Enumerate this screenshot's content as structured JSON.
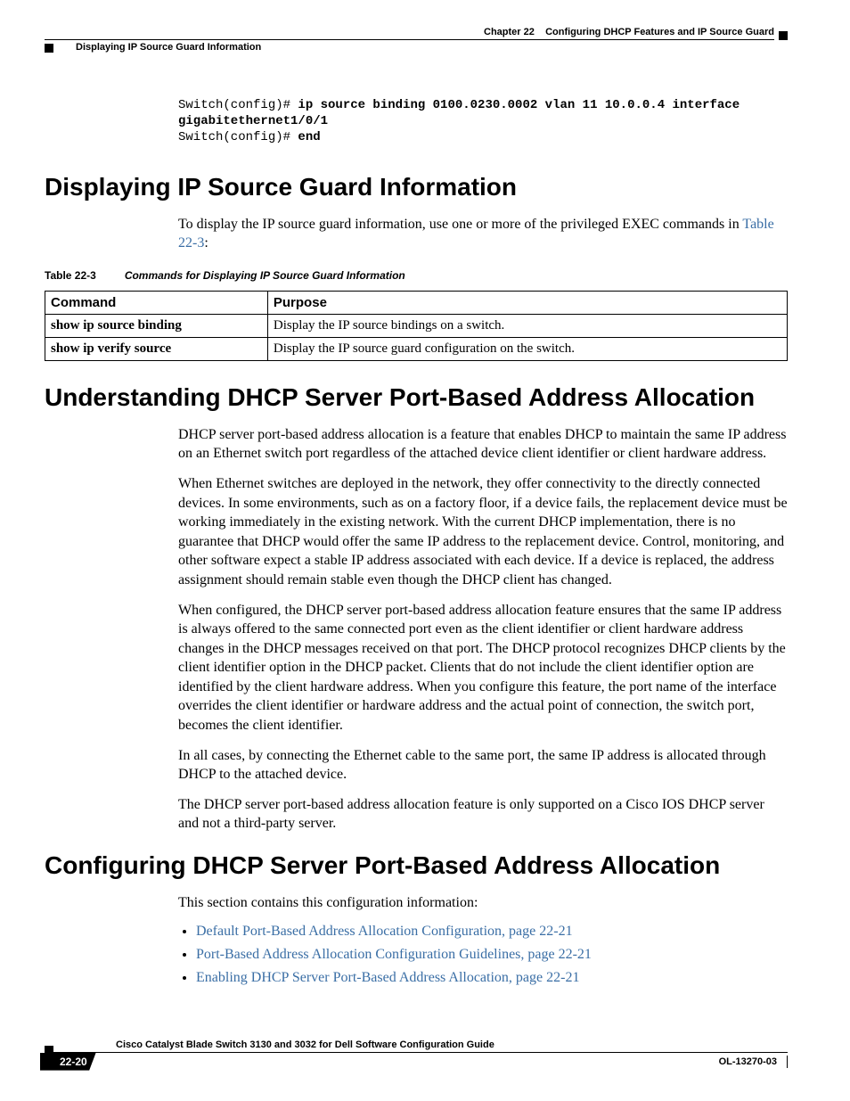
{
  "header": {
    "chapter": "Chapter 22    Configuring DHCP Features and IP Source Guard",
    "section": "Displaying IP Source Guard Information"
  },
  "code": {
    "prompt1": "Switch(config)# ",
    "cmd1": "ip source binding 0100.0230.0002 vlan 11 10.0.0.4 interface gigabitethernet1/0/1",
    "prompt2": "Switch(config)# ",
    "cmd2": "end"
  },
  "sec1": {
    "heading": "Displaying IP Source Guard Information",
    "intro_pre": "To display the IP source guard information, use one or more of the privileged EXEC commands in ",
    "intro_link": "Table 22-3",
    "intro_post": ":",
    "table_caption_num": "Table 22-3",
    "table_caption_title": "Commands for Displaying IP Source Guard Information",
    "th_cmd": "Command",
    "th_purpose": "Purpose",
    "rows": [
      {
        "cmd": "show ip source binding",
        "purpose": "Display the IP source bindings on a switch."
      },
      {
        "cmd": "show ip verify source",
        "purpose": "Display the IP source guard configuration on the switch."
      }
    ]
  },
  "sec2": {
    "heading": "Understanding DHCP Server Port-Based Address Allocation",
    "p1": "DHCP server port-based address allocation is a feature that enables DHCP to maintain the same IP address on an Ethernet switch port regardless of the attached device client identifier or client hardware address.",
    "p2": "When Ethernet switches are deployed in the network, they offer connectivity to the directly connected devices. In some environments, such as on a factory floor, if a device fails, the replacement device must be working immediately in the existing network. With the current DHCP implementation, there is no guarantee that DHCP would offer the same IP address to the replacement device. Control, monitoring, and other software expect a stable IP address associated with each device. If a device is replaced, the address assignment should remain stable even though the DHCP client has changed.",
    "p3": "When configured, the DHCP server port-based address allocation feature ensures that the same IP address is always offered to the same connected port even as the client identifier or client hardware address changes in the DHCP messages received on that port. The DHCP protocol recognizes DHCP clients by the client identifier option in the DHCP packet. Clients that do not include the client identifier option are identified by the client hardware address. When you configure this feature, the port name of the interface overrides the client identifier or hardware address and the actual point of connection, the switch port, becomes the client identifier.",
    "p4": "In all cases, by connecting the Ethernet cable to the same port, the same IP address is allocated through DHCP to the attached device.",
    "p5": "The DHCP server port-based address allocation feature is only supported on a Cisco IOS DHCP server and not a third-party server."
  },
  "sec3": {
    "heading": "Configuring DHCP Server Port-Based Address Allocation",
    "intro": "This section contains this configuration information:",
    "links": [
      "Default Port-Based Address Allocation Configuration, page 22-21",
      "Port-Based Address Allocation Configuration Guidelines, page 22-21",
      "Enabling DHCP Server Port-Based Address Allocation, page 22-21"
    ]
  },
  "footer": {
    "book": "Cisco Catalyst Blade Switch 3130 and 3032 for Dell Software Configuration Guide",
    "page": "22-20",
    "docid": "OL-13270-03"
  }
}
